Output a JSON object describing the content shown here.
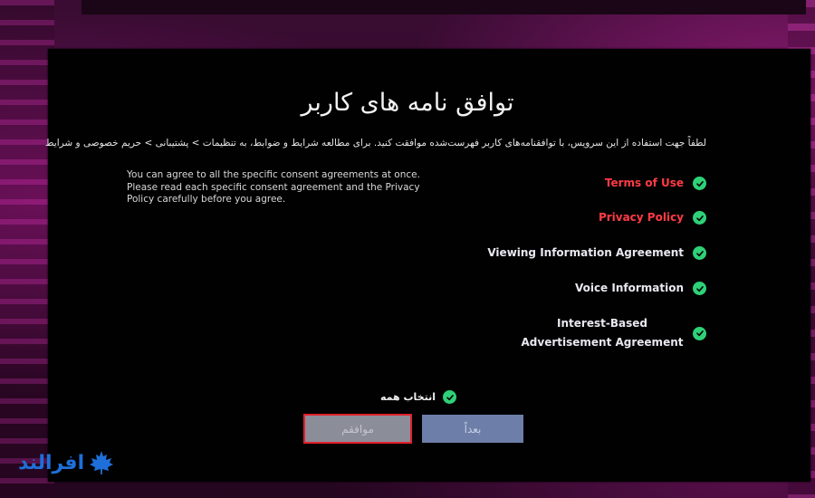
{
  "screen": {
    "title": "توافق نامه های کاربر",
    "subtitle": "لطفاً جهت استفاده از این سرویس، با توافقنامه‌های کاربر فهرست‌شده موافقت کنید. برای مطالعه شرایط و ضوابط، به تنظیمات > پشتیبانی > حریم خصوصی و شرایط",
    "description": "You can agree to all the specific consent agreements at once. Please read each specific consent agreement and the Privacy Policy carefully before you agree."
  },
  "agreements": [
    {
      "label": "Terms of Use",
      "link": true,
      "checked": true
    },
    {
      "label": "Privacy Policy",
      "link": true,
      "checked": true
    },
    {
      "label": "Viewing Information Agreement",
      "link": false,
      "checked": true
    },
    {
      "label": "Voice Information",
      "link": false,
      "checked": true
    },
    {
      "label": "Interest-Based Advertisement Agreement",
      "link": false,
      "checked": true
    }
  ],
  "select_all": {
    "label": "انتخاب همه",
    "checked": true
  },
  "buttons": {
    "agree_label": "موافقم",
    "later_label": "بعداً"
  },
  "watermark": {
    "text": "افرالند"
  },
  "colors": {
    "check": "#2ed177",
    "link": "#ff3b45",
    "agree_button_border": "#e0212c",
    "logo": "#1e6fd9"
  },
  "icons": {
    "check": "check-icon",
    "logo": "maple-leaf-icon"
  }
}
